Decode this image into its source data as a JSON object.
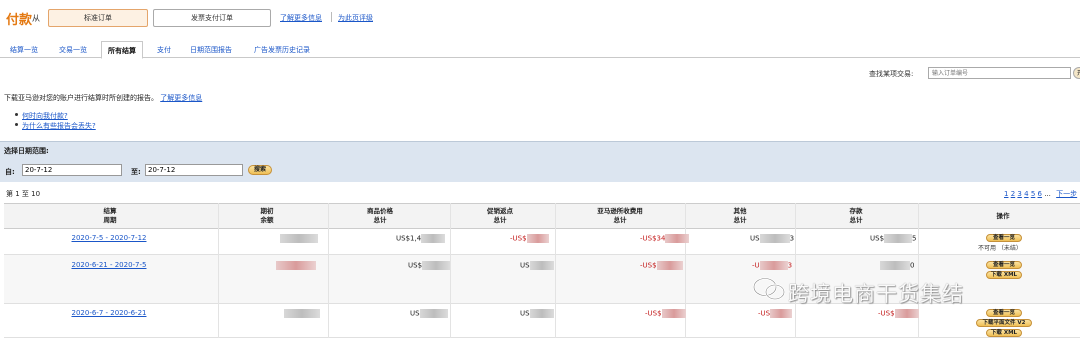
{
  "header": {
    "title": "付款",
    "from": "从",
    "standard_orders": "标准订单",
    "invoiced_orders": "发票支付订单",
    "learn_more": "了解更多信息",
    "rate_page": "为此页评级"
  },
  "tabs": [
    "结算一览",
    "交易一览",
    "所有结算",
    "支付",
    "日期范围报告",
    "广告发票历史记录"
  ],
  "active_tab": "所有结算",
  "find": {
    "label": "查找某项交易:",
    "placeholder": "输入订单编号",
    "go": "开"
  },
  "description": {
    "text": "下载亚马逊对您的账户进行结算时所创建的报告。",
    "link": "了解更多信息"
  },
  "bullets": [
    "何时向我付款?",
    "为什么有些报告会丢失?"
  ],
  "date_range": {
    "title": "选择日期范围:",
    "from_label": "自:",
    "from_value": "20-7-12",
    "to_label": "至:",
    "to_value": "20-7-12",
    "search": "搜索"
  },
  "results": {
    "count": "第 1 至 10",
    "pages": [
      "1",
      "2",
      "3",
      "4",
      "5",
      "6",
      "...",
      "下一步"
    ]
  },
  "table": {
    "headers": [
      [
        "结算",
        "周期"
      ],
      [
        "期初",
        "余额"
      ],
      [
        "商品价格",
        "总计"
      ],
      [
        "促销返点",
        "总计"
      ],
      [
        "亚马逊所收费用",
        "总计"
      ],
      [
        "其他",
        "总计"
      ],
      [
        "存款",
        "总计"
      ],
      [
        "操作",
        ""
      ]
    ],
    "rows": [
      {
        "period": "2020-7-5 - 2020-7-12",
        "product": "US$1,4",
        "promo": "-US$",
        "fees": "-US$34",
        "other_pre": "US",
        "other_post": "3",
        "deposit_pre": "US$",
        "deposit_post": "5",
        "actions": [
          "查看一览"
        ],
        "status": "不可用 （未结）"
      },
      {
        "period": "2020-6-21 - 2020-7-5",
        "product": "US$",
        "promo": "US",
        "fees": "-US$",
        "other_pre": "-U",
        "other_post": "3",
        "deposit_post": "0",
        "actions": [
          "查看一览",
          "下载 XML"
        ]
      },
      {
        "period": "2020-6-7 - 2020-6-21",
        "product": "US",
        "promo": "US",
        "fees": "-US$",
        "other_pre": "-US",
        "deposit_pre": "-US$",
        "actions": [
          "查看一览",
          "下载平面文件 V2",
          "下载 XML"
        ]
      }
    ]
  },
  "watermark": "跨境电商干货集结"
}
